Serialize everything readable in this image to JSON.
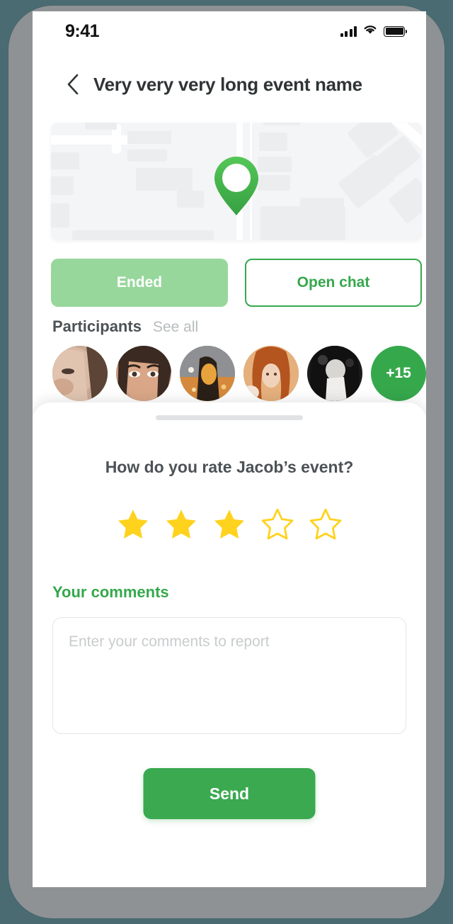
{
  "status_bar": {
    "time": "9:41",
    "signal_icon": "cellular-signal-icon",
    "wifi_icon": "wifi-icon",
    "battery_icon": "battery-full-icon"
  },
  "header": {
    "back_icon": "chevron-left-icon",
    "title": "Very very very long event name"
  },
  "map": {
    "pin_icon": "location-pin-icon",
    "pin_color": "#4bbb50",
    "background_color": "#f4f5f7",
    "building_color": "#ebedef",
    "road_color": "#ffffff"
  },
  "actions": {
    "ended_label": "Ended",
    "ended_color": "#97d79c",
    "open_chat_label": "Open chat",
    "open_chat_color": "#36a84c"
  },
  "participants": {
    "title": "Participants",
    "see_all_label": "See all",
    "more_count_label": "+15",
    "avatars": [
      {
        "name": "participant-avatar-1"
      },
      {
        "name": "participant-avatar-2"
      },
      {
        "name": "participant-avatar-3"
      },
      {
        "name": "participant-avatar-4"
      },
      {
        "name": "participant-avatar-5"
      }
    ]
  },
  "rating_sheet": {
    "handle": "drag-handle",
    "question": "How do you rate Jacob’s event?",
    "stars": {
      "total": 5,
      "selected": 3,
      "filled_color": "#ffd21e",
      "empty_color": "#ffd21e"
    },
    "comments_label": "Your comments",
    "comments_value": "",
    "comments_placeholder": "Enter your comments to report",
    "send_label": "Send",
    "send_color": "#3aa950"
  }
}
